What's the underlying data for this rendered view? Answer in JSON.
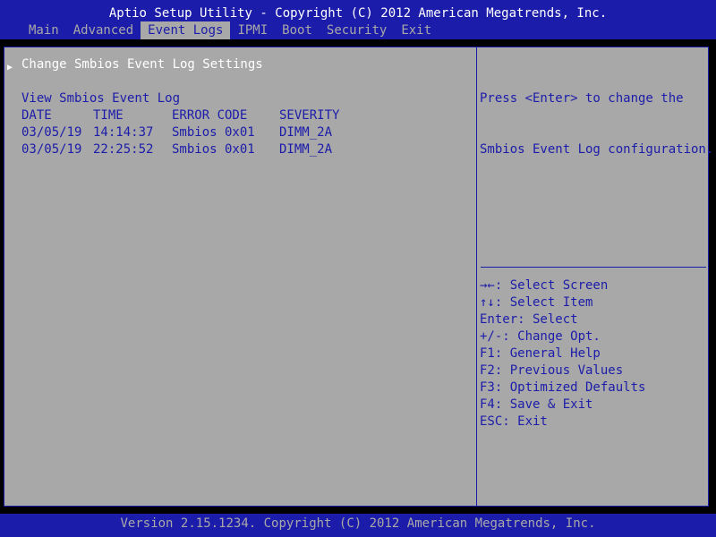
{
  "header": {
    "title": "Aptio Setup Utility - Copyright (C) 2012 American Megatrends, Inc."
  },
  "menu": {
    "items": [
      {
        "label": "Main",
        "active": false
      },
      {
        "label": "Advanced",
        "active": false
      },
      {
        "label": "Event Logs",
        "active": true
      },
      {
        "label": "IPMI",
        "active": false
      },
      {
        "label": "Boot",
        "active": false
      },
      {
        "label": "Security",
        "active": false
      },
      {
        "label": "Exit",
        "active": false
      }
    ]
  },
  "main": {
    "submenu_label": "Change Smbios Event Log Settings",
    "section_title": "View Smbios Event Log",
    "table": {
      "headers": [
        "DATE",
        "TIME",
        "ERROR CODE",
        "SEVERITY"
      ],
      "rows": [
        [
          "03/05/19",
          "14:14:37",
          "Smbios 0x01",
          "DIMM_2A"
        ],
        [
          "03/05/19",
          "22:25:52",
          "Smbios 0x01",
          "DIMM_2A"
        ]
      ]
    }
  },
  "help": {
    "lines": [
      "Press <Enter> to change the",
      "Smbios Event Log configuration."
    ]
  },
  "keys": [
    "→←: Select Screen",
    "↑↓: Select Item",
    "Enter: Select",
    "+/-: Change Opt.",
    "F1: General Help",
    "F2: Previous Values",
    "F3: Optimized Defaults",
    "F4: Save & Exit",
    "ESC: Exit"
  ],
  "footer": {
    "text": "Version 2.15.1234. Copyright (C) 2012 American Megatrends, Inc."
  },
  "colors": {
    "bios_blue": "#1c1caa",
    "bios_gray": "#a8a8a8",
    "text_white": "#ffffff"
  }
}
